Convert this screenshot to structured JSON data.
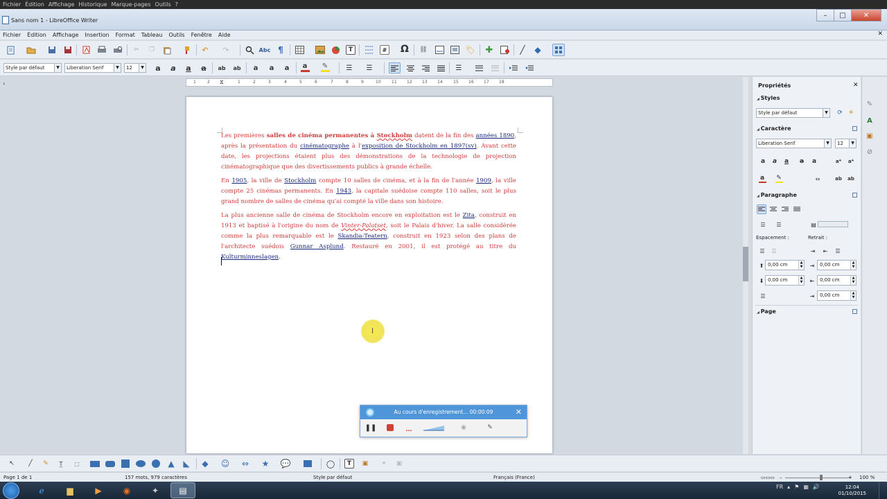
{
  "background_menu": [
    "Fichier",
    "Édition",
    "Affichage",
    "Historique",
    "Marque-pages",
    "Outils",
    "?"
  ],
  "window": {
    "title": "Sans nom 1 - LibreOffice Writer"
  },
  "menubar": [
    "Fichier",
    "Édition",
    "Affichage",
    "Insertion",
    "Format",
    "Tableau",
    "Outils",
    "Fenêtre",
    "Aide"
  ],
  "formatting": {
    "paragraph_style": "Style par défaut",
    "font_name": "Liberation Serif",
    "font_size": "12"
  },
  "ruler": {
    "numbers": [
      "1",
      "2",
      "1",
      "2",
      "3",
      "4",
      "5",
      "6",
      "7",
      "8",
      "9",
      "10",
      "11",
      "12",
      "13",
      "14",
      "15",
      "16",
      "17",
      "18"
    ]
  },
  "document": {
    "p1": {
      "a": "Les premières ",
      "b": "salles de cinéma permanentes à ",
      "b2": "Stockholm",
      "c": " datent de la fin des ",
      "l1": "années 1890",
      "d": ", après la présentation du ",
      "l2": "cinématographe",
      "e": " à l'",
      "l3": "exposition de Stockholm en 1897",
      "l4": "(sv)",
      "f": ". Avant cette date, les projections étaient plus des démonstrations de la technologie de projection cinématographique que des divertissements publics à grande échelle."
    },
    "p2": {
      "a": "En ",
      "l1": "1905",
      "b": ", la ville de ",
      "l2": "Stockholm",
      "c": " compte 10 salles de cinéma, et à la fin de l'année ",
      "l3": "1909",
      "d": ", la ville compte 25 cinémas permanents. En ",
      "l4": "1943",
      "e": ", la capitale suédoise compte 110 salles, soit le plus grand nombre de salles de cinéma qu'ai compté la ville dans son histoire."
    },
    "p3": {
      "a": "La plus ancienne salle de cinéma de Stockholm encore en exploitation est le ",
      "l1": "Zita",
      "b": ", construit en 1913 et baptisé à l'origine du nom de ",
      "i1": "Vinter-Palatset",
      "c": ", soit le Palais d'hiver. La salle considérée comme la plus remarquable est le ",
      "l2": "Skandia-Teatern",
      "d": ", construit en 1923 selon des plans de l'architecte suédois ",
      "l3": "Gunnar Asplund",
      "e": ". Restauré en 2001, il est protégé au titre du ",
      "l4": "Kulturminneslagen",
      "f": "."
    }
  },
  "click_indicator": "I",
  "sidebar": {
    "title": "Propriétés",
    "styles_header": "Styles",
    "style_value": "Style par défaut",
    "character_header": "Caractère",
    "font_name": "Liberation Serif",
    "font_size": "12",
    "paragraph_header": "Paragraphe",
    "spacing_label": "Espacement :",
    "indent_label": "Retrait :",
    "spacing_above": "0,00 cm",
    "spacing_below": "0,00 cm",
    "indent_before": "0,00 cm",
    "indent_after": "0,00 cm",
    "indent_first": "0,00 cm",
    "page_header": "Page"
  },
  "recorder": {
    "status": "Au cours d'enregistrement... 00:00:09"
  },
  "statusbar": {
    "page": "Page 1 de 1",
    "words": "157 mots, 979 caractères",
    "style": "Style par défaut",
    "language": "Français (France)",
    "zoom": "100 %"
  },
  "taskbar": {
    "lang": "FR",
    "time": "12:04",
    "date": "01/10/2015"
  },
  "colors": {
    "text_red": "#d23a3a",
    "link_blue": "#1b2a7a",
    "recorder_blue": "#4f95d9",
    "cursor_highlight": "#f1e35a"
  }
}
